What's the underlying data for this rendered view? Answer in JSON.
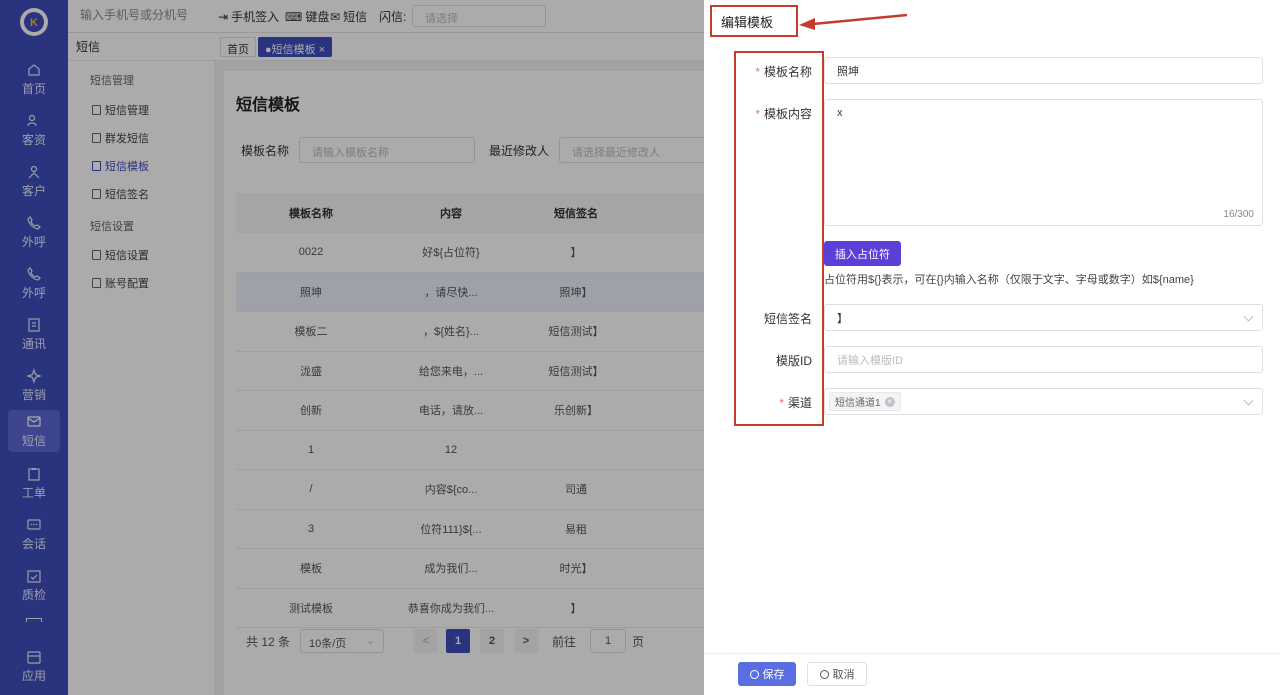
{
  "topbar": {
    "phone_placeholder": "输入手机号或分机号",
    "tools": [
      "手机签入",
      "键盘",
      "短信",
      "闪信:"
    ],
    "flash_placeholder": "请选择"
  },
  "rail": {
    "items": [
      "首页",
      "客资",
      "客户",
      "外呼",
      "外呼",
      "通讯",
      "营销",
      "短信",
      "工单",
      "会话",
      "质检",
      "应用"
    ]
  },
  "subnav": {
    "title": "短信",
    "group1": "短信管理",
    "group1_items": [
      "短信管理",
      "群发短信",
      "短信模板",
      "短信签名"
    ],
    "group2": "短信设置",
    "group2_items": [
      "短信设置",
      "账号配置"
    ]
  },
  "tabs": {
    "home": "首页",
    "active": "●短信模板 ×"
  },
  "page": {
    "title": "短信模板",
    "filter_name_label": "模板名称",
    "filter_name_placeholder": "请输入模板名称",
    "filter_modifier_label": "最近修改人",
    "filter_modifier_placeholder": "请选择最近修改人"
  },
  "table": {
    "headers": [
      "模板名称",
      "内容",
      "短信签名"
    ],
    "rows": [
      [
        "0022",
        "好${占位符}",
        "】"
      ],
      [
        "照坤",
        "，请尽快...",
        "照坤】"
      ],
      [
        "模板二",
        "，${姓名}...",
        "短信测试】"
      ],
      [
        "泷盛",
        "给您来电，...",
        "短信测试】"
      ],
      [
        "创新",
        "电话，请放...",
        "乐创新】"
      ],
      [
        "1",
        "12",
        ""
      ],
      [
        "/",
        "内容${co...",
        "司通"
      ],
      [
        "3",
        "位符111}${...",
        "易租"
      ],
      [
        "模板",
        "成为我们...",
        "时光】"
      ],
      [
        "测试模板",
        "恭喜你成为我们...",
        "】"
      ]
    ]
  },
  "pager": {
    "total": "共 12 条",
    "size": "10条/页",
    "prev": "<",
    "pages": [
      "1",
      "2"
    ],
    "next": ">",
    "goto": "前往",
    "goto_value": "1",
    "page_unit": "页"
  },
  "drawer": {
    "title": "编辑模板",
    "name_label": "模板名称",
    "name_value": "照坤",
    "content_label": "模板内容",
    "content_value": "x",
    "char_count": "16/300",
    "insert_button": "插入占位符",
    "hint": "占位符用${}表示，可在{}内输入名称（仅限于文字、字母或数字）如${name}",
    "sign_label": "短信签名",
    "sign_value": "】",
    "template_id_label": "模版ID",
    "template_id_placeholder": "请输入模版ID",
    "channel_label": "渠道",
    "channel_chip": "短信通道1",
    "save": "保存",
    "cancel": "取消"
  },
  "colors": {
    "rail": "#3f4dbb",
    "primary": "#3f4dbb",
    "annotation_red": "#c43c2c",
    "insert_button": "#5b3fd6"
  }
}
